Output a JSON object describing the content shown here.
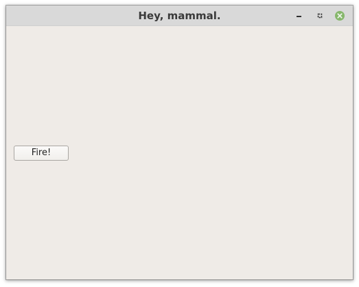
{
  "window": {
    "title": "Hey, mammal."
  },
  "controls": {
    "minimize_icon": "minimize-icon",
    "maximize_icon": "maximize-icon",
    "close_icon": "close-icon",
    "close_color": "#86b76b"
  },
  "main": {
    "fire_button_label": "Fire!"
  }
}
